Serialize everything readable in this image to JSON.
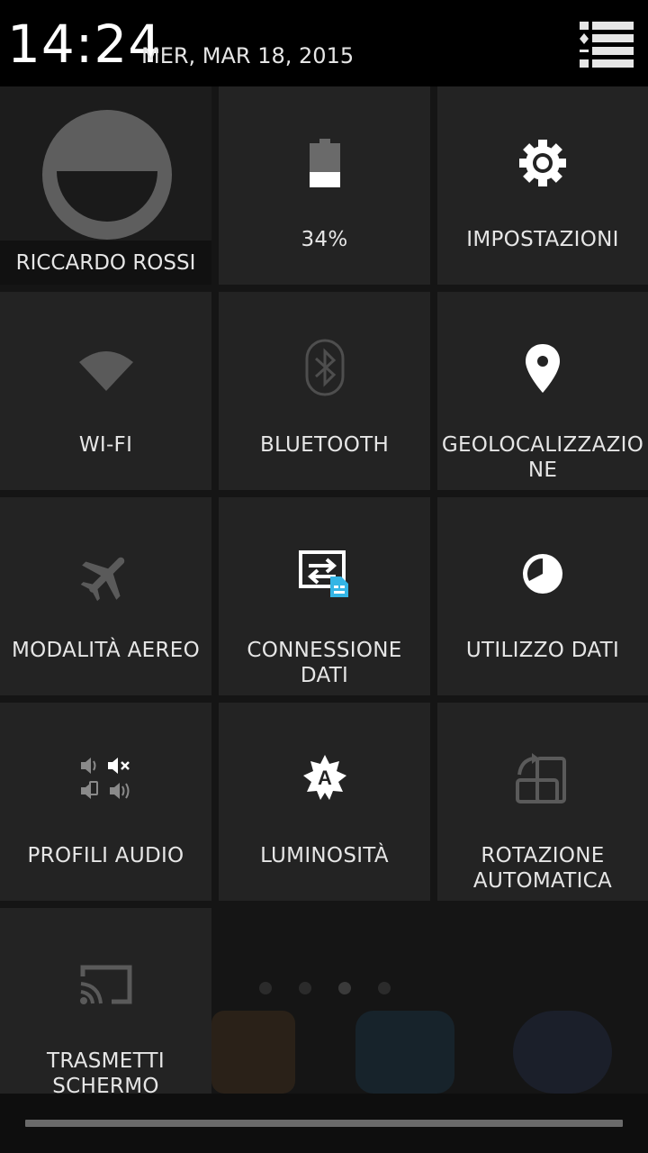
{
  "status_bar": {
    "time": "14:24",
    "date": "MER, MAR 18, 2015",
    "settings_icon": "list-settings-icon"
  },
  "user": {
    "name": "RICCARDO ROSSI",
    "avatar_icon": "default-avatar-icon"
  },
  "tiles": [
    {
      "id": "battery",
      "label": "34%",
      "icon": "battery-icon",
      "battery_level": 0.34
    },
    {
      "id": "settings",
      "label": "IMPOSTAZIONI",
      "icon": "gear-icon"
    },
    {
      "id": "wifi",
      "label": "WI-FI",
      "icon": "wifi-icon",
      "state": "off"
    },
    {
      "id": "bluetooth",
      "label": "BLUETOOTH",
      "icon": "bluetooth-icon",
      "state": "off"
    },
    {
      "id": "location",
      "label_line1": "GEOLOCALIZZAZIO",
      "label_line2": "NE",
      "icon": "location-pin-icon",
      "state": "on"
    },
    {
      "id": "airplane",
      "label": "MODALITÀ AEREO",
      "icon": "airplane-icon",
      "state": "off"
    },
    {
      "id": "data",
      "label_line1": "CONNESSIONE",
      "label_line2": "DATI",
      "icon": "mobile-data-icon",
      "state": "on"
    },
    {
      "id": "data_usage",
      "label": "UTILIZZO DATI",
      "icon": "data-usage-icon"
    },
    {
      "id": "audio",
      "label": "PROFILI AUDIO",
      "icon": "audio-profiles-icon"
    },
    {
      "id": "brightness",
      "label": "LUMINOSITÀ",
      "icon": "brightness-auto-icon"
    },
    {
      "id": "rotation",
      "label_line1": "ROTAZIONE",
      "label_line2": "AUTOMATICA",
      "icon": "auto-rotate-icon",
      "state": "off"
    },
    {
      "id": "cast",
      "label_line1": "TRASMETTI",
      "label_line2": "SCHERMO",
      "icon": "cast-icon",
      "state": "off"
    }
  ],
  "colors": {
    "tile_bg": "#232323",
    "icon_on": "#ffffff",
    "icon_off": "#5a5a5a",
    "accent_blue": "#33b5e5"
  }
}
